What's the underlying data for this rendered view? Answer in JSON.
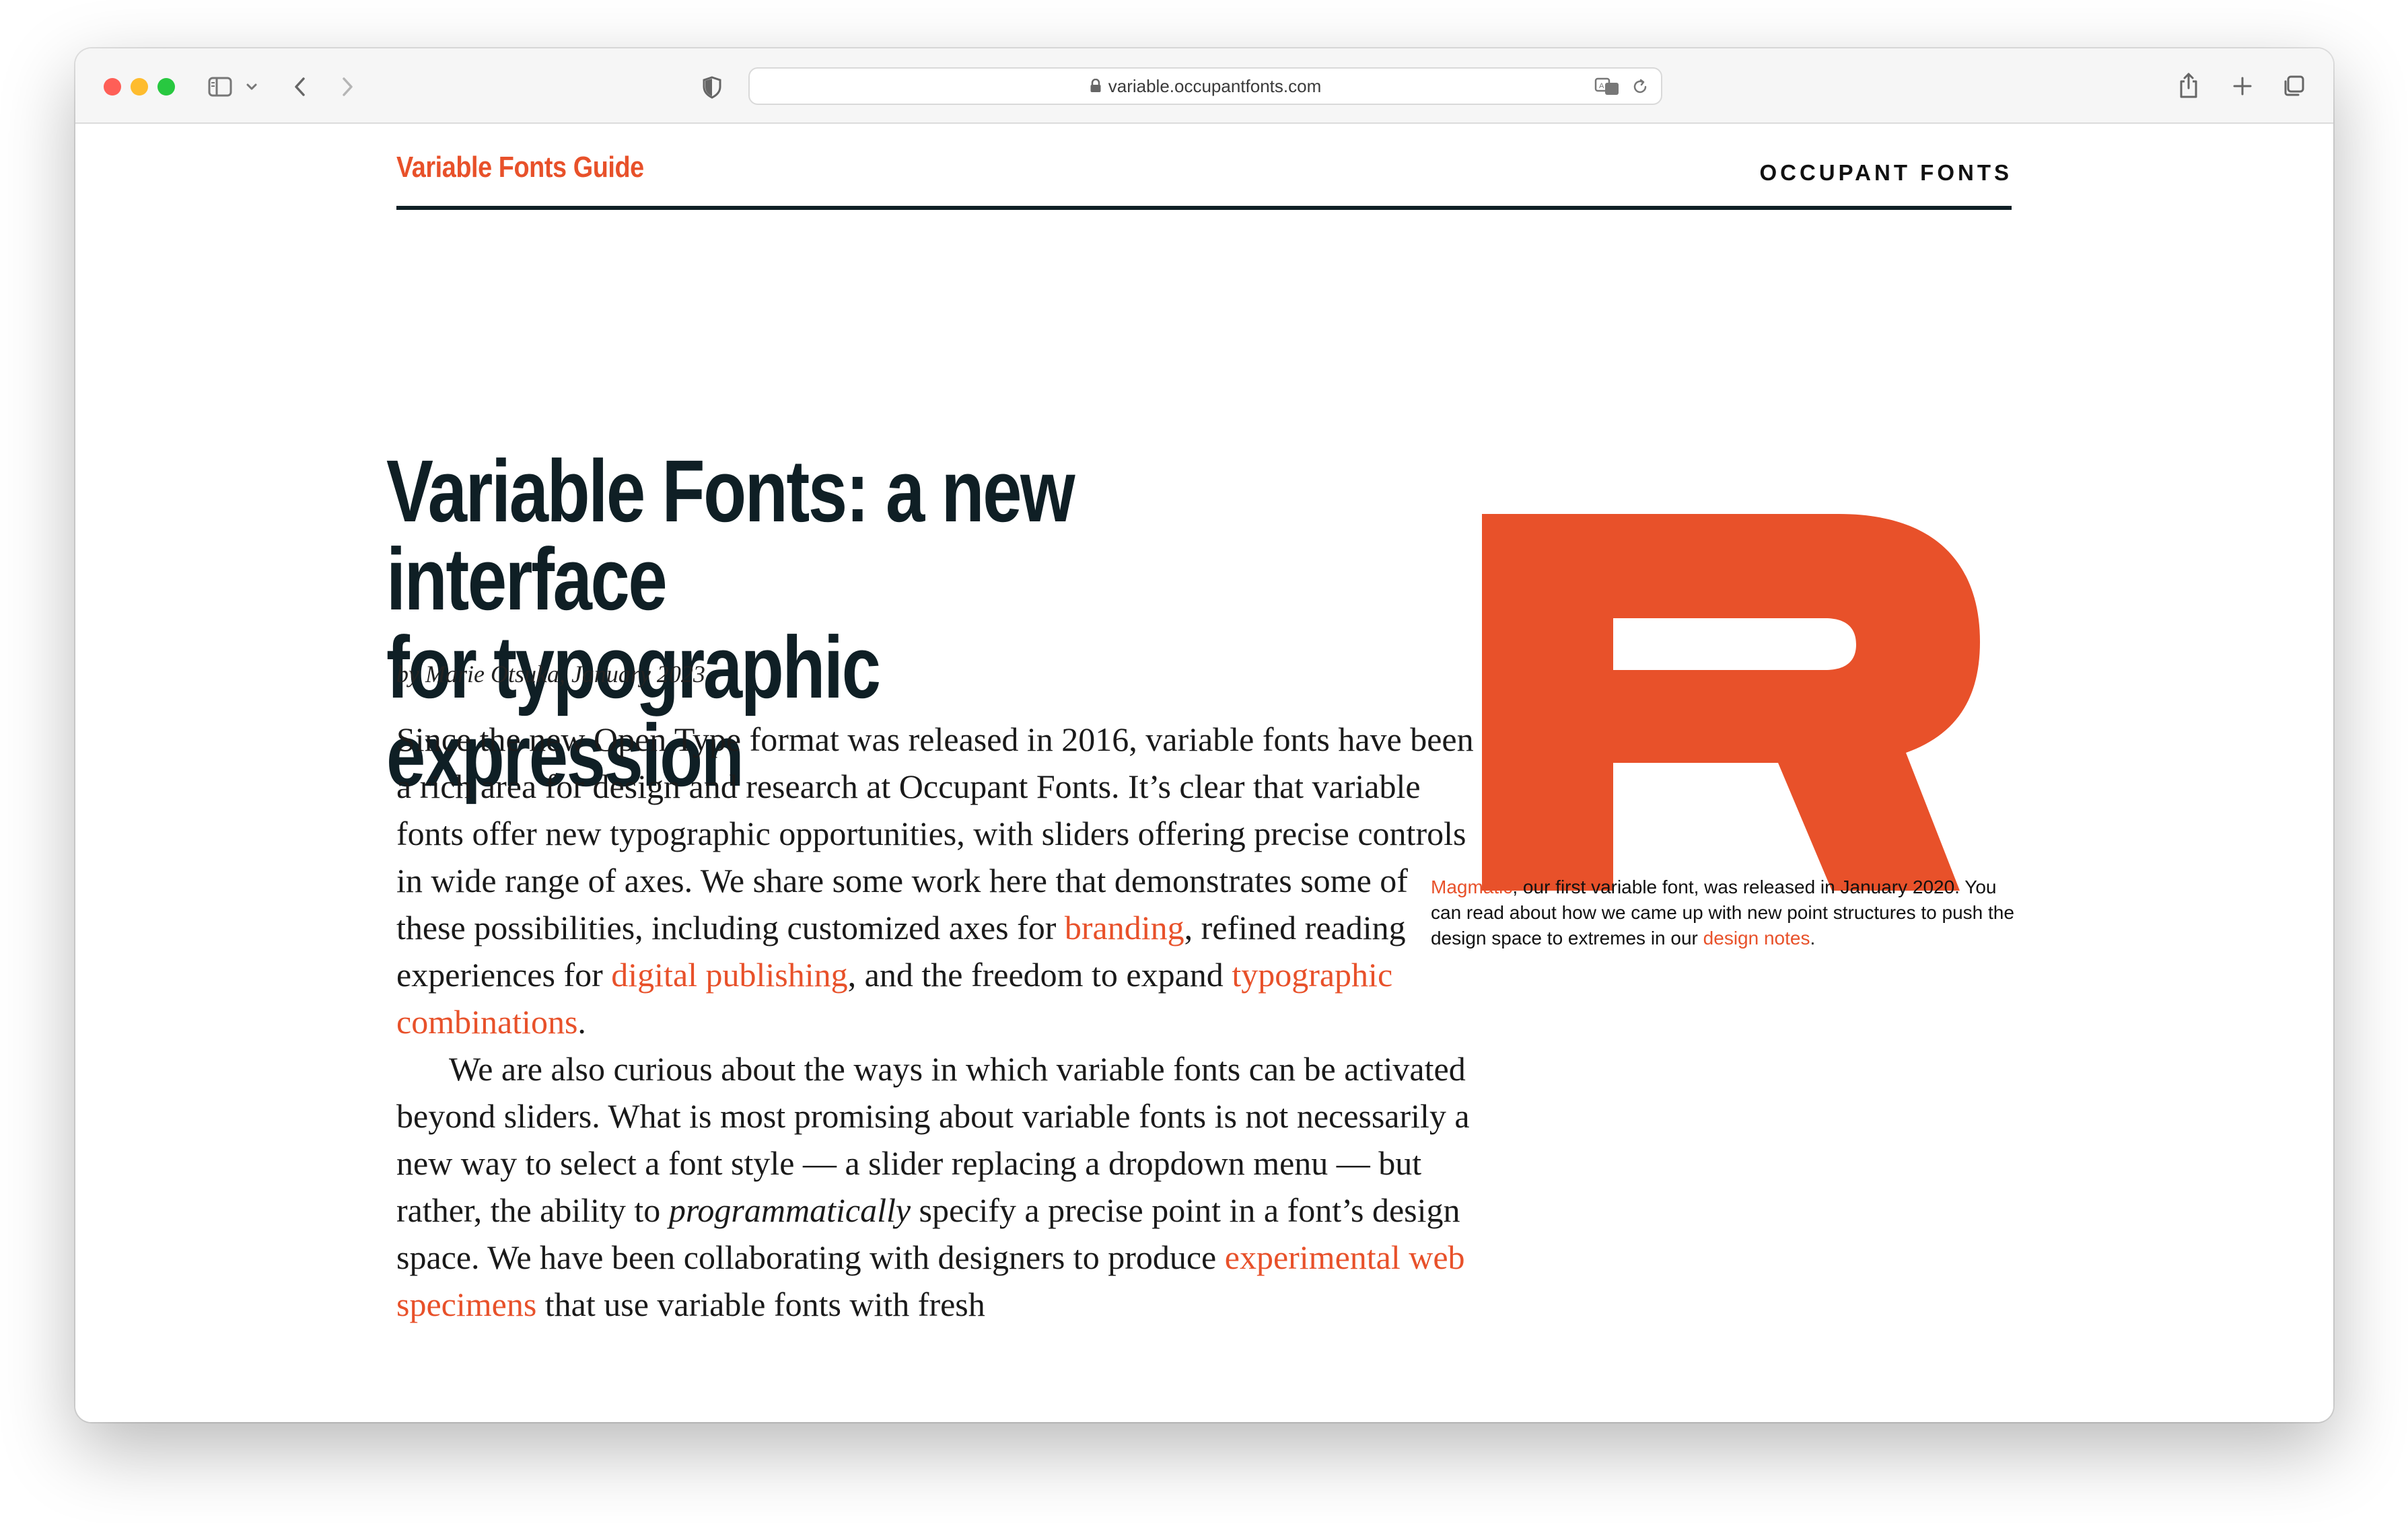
{
  "browser": {
    "url": "variable.occupantfonts.com"
  },
  "site": {
    "guide_title": "Variable Fonts Guide",
    "brand": "OCCUPANT FONTS"
  },
  "article": {
    "headline_line1": "Variable Fonts: a new interface",
    "headline_line2": "for typographic expression",
    "byline": "by Marie Otsuka, January 2023",
    "p1": {
      "t1": "Since the new Open Type format was released in 2016, variable fonts have been a rich area for design and research at Occupant Fonts. It’s clear that variable fonts offer new typographic opportunities, with sliders offering precise controls in wide range of axes. We share some work here that demonstrates some of these possibilities, including customized axes for ",
      "link1": "branding",
      "t2": ", refined reading experiences for ",
      "link2": "digital publishing",
      "t3": ", and the freedom to expand ",
      "link3": "typographic combinations",
      "t4": "."
    },
    "p2": {
      "t1": "We are also curious about the ways in which variable fonts can be activated beyond sliders. What is most promising about variable fonts is not necessarily a new way to select a font style — a slider replacing a dropdown menu — but rather, the ability to ",
      "em": "programmatically",
      "t2": " specify a precise point in a font’s design space. We have been collaborating with designers to produce ",
      "link1": "experimental web specimens",
      "t3": " that use variable fonts with fresh"
    }
  },
  "figure": {
    "letter": "R",
    "color": "#e8512a",
    "caption": {
      "link1": "Magmatic",
      "t1": ", our first variable font, was released in January 2020. You can read about how we came up with new point structures to push the design space to extremes in our ",
      "link2": "design notes",
      "t2": "."
    }
  },
  "colors": {
    "accent": "#e8512a",
    "ink": "#0f1f25"
  }
}
